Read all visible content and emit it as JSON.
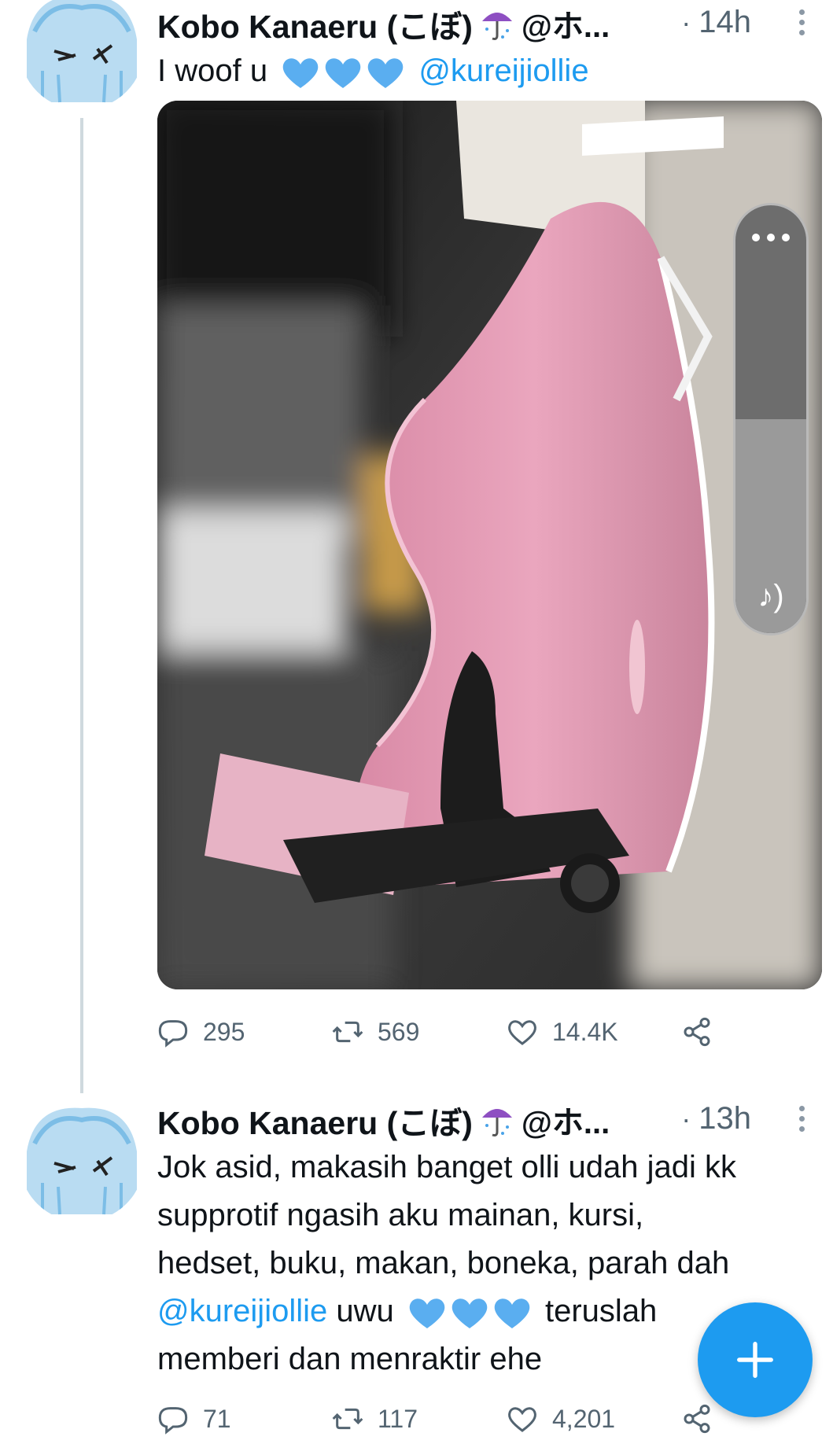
{
  "tweets": [
    {
      "author_name": "Kobo Kanaeru (こぼ)",
      "handle": "@ホ...",
      "separator": "·",
      "time": "14h",
      "text_pre": "I woof u",
      "mention": "@kureijiollie",
      "hearts": [
        "blue-heart-emoji",
        "blue-heart-emoji",
        "blue-heart-emoji"
      ],
      "stats": {
        "replies": "295",
        "retweets": "569",
        "likes": "14.4K"
      },
      "media": {
        "kind": "video",
        "volume_level": 0.5
      }
    },
    {
      "author_name": "Kobo Kanaeru (こぼ)",
      "handle": "@ホ...",
      "separator": "·",
      "time": "13h",
      "text_line1": "Jok asid, makasih banget olli udah jadi kk",
      "text_line2": "supprotif ngasih aku mainan, kursi,",
      "text_line3": "hedset, buku, makan, boneka, parah dah",
      "mention": "@kureijiollie",
      "after_mention": "uwu",
      "after_hearts": "teruslah",
      "text_line5": "memberi dan menraktir ehe",
      "stats": {
        "replies": "71",
        "retweets": "117",
        "likes": "4,201"
      }
    }
  ],
  "icons": {
    "umbrella": "purple-umbrella-emoji",
    "reply": "reply-icon",
    "retweet": "retweet-icon",
    "like": "heart-icon",
    "share": "share-icon",
    "compose": "plus-icon",
    "sound": "sound-icon"
  },
  "colors": {
    "accent": "#1d9bf0",
    "secondary_text": "#536471",
    "primary_text": "#0f1419",
    "thread_line": "#cfd9de"
  }
}
